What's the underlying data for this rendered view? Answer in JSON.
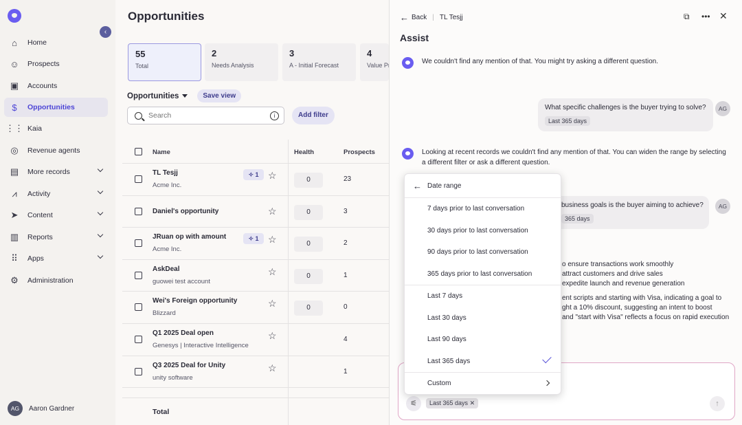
{
  "sidebar": {
    "items": [
      {
        "label": "Home",
        "icon": "home-icon"
      },
      {
        "label": "Prospects",
        "icon": "person-icon"
      },
      {
        "label": "Accounts",
        "icon": "briefcase-icon"
      },
      {
        "label": "Opportunities",
        "icon": "dollar-icon"
      },
      {
        "label": "Kaia",
        "icon": "waveform-icon"
      },
      {
        "label": "Revenue agents",
        "icon": "agent-icon"
      },
      {
        "label": "More records",
        "icon": "records-icon"
      },
      {
        "label": "Activity",
        "icon": "activity-icon"
      },
      {
        "label": "Content",
        "icon": "send-icon"
      },
      {
        "label": "Reports",
        "icon": "bar-chart-icon"
      },
      {
        "label": "Apps",
        "icon": "grid-icon"
      },
      {
        "label": "Administration",
        "icon": "gear-icon"
      }
    ],
    "user": {
      "initials": "AG",
      "name": "Aaron Gardner"
    }
  },
  "main": {
    "title": "Opportunities",
    "stats": [
      {
        "num": "55",
        "cap": "Total"
      },
      {
        "num": "2",
        "cap": "Needs Analysis"
      },
      {
        "num": "3",
        "cap": "A - Initial Forecast"
      },
      {
        "num": "4",
        "cap": "Value Pr"
      }
    ],
    "view_title": "Opportunities",
    "save_view": "Save view",
    "search_placeholder": "Search",
    "add_filter": "Add filter",
    "columns": {
      "name": "Name",
      "health": "Health",
      "prospects": "Prospects"
    },
    "rows": [
      {
        "name": "TL Tesjj",
        "sub": "Acme Inc.",
        "ai": "1",
        "health": "0",
        "prospects": "23"
      },
      {
        "name": "Daniel's opportunity",
        "sub": "",
        "ai": "",
        "health": "0",
        "prospects": "3"
      },
      {
        "name": "JRuan op with amount",
        "sub": "Acme Inc.",
        "ai": "1",
        "health": "0",
        "prospects": "2"
      },
      {
        "name": "AskDeal",
        "sub": "guowei test account",
        "ai": "",
        "health": "0",
        "prospects": "1"
      },
      {
        "name": "Wei's Foreign opportunity",
        "sub": "Blizzard",
        "ai": "",
        "health": "0",
        "prospects": "0"
      },
      {
        "name": "Q1 2025 Deal open",
        "sub": "Genesys | Interactive Intelligence",
        "ai": "",
        "health": "",
        "prospects": "4"
      },
      {
        "name": "Q3 2025 Deal for Unity",
        "sub": "unity software",
        "ai": "",
        "health": "",
        "prospects": "1"
      }
    ],
    "total_label": "Total"
  },
  "panel": {
    "back": "Back",
    "record": "TL Tesjj",
    "title": "Assist",
    "msg1": "We couldn't find any mention of that. You might try asking a different question.",
    "q1": "What specific challenges is the buyer trying to solve?",
    "q1_pill": "Last 365 days",
    "msg2": "Looking at recent records we couldn't find any mention of that. You can widen the range by selecting a different filter or ask a different question.",
    "q2": "business goals is the buyer aiming to achieve?",
    "q2_pill": "365 days",
    "user_initials": "AG",
    "lines": [
      "o ensure transactions work smoothly",
      "attract customers and drive sales",
      "expedite launch and revenue generation",
      "ent scripts and starting with Visa, indicating a goal to",
      "ght a 10% discount, suggesting an intent to boost",
      " and \"start with Visa\" reflects a focus on rapid execution"
    ],
    "composer_chip": "Last 365 days",
    "dropdown": {
      "header": "Date range",
      "group1": [
        "7 days prior to last conversation",
        "30 days prior to last conversation",
        "90 days prior to last conversation",
        "365 days prior to last conversation"
      ],
      "group2": [
        "Last 7 days",
        "Last 30 days",
        "Last 90 days",
        "Last 365 days"
      ],
      "selected": "Last 365 days",
      "custom": "Custom"
    }
  }
}
